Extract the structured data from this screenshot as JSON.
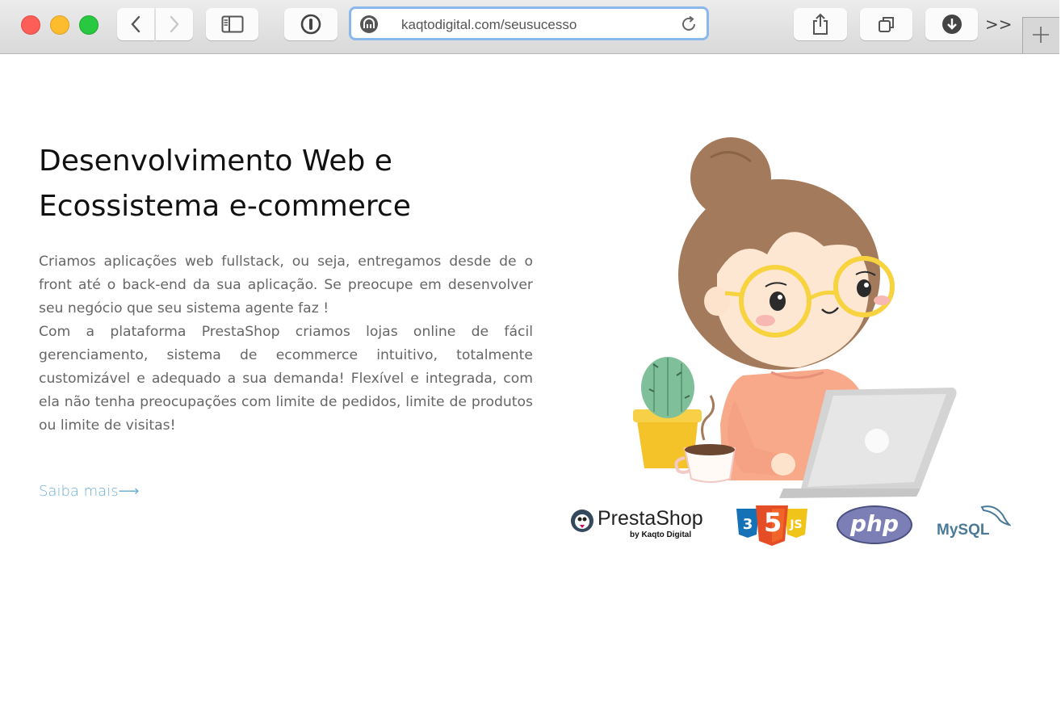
{
  "browser": {
    "url": "kaqtodigital.com/seusucesso",
    "overflow_label": ">>"
  },
  "hero": {
    "title_line1": "Desenvolvimento Web e",
    "title_line2": "Ecossistema e-commerce",
    "paragraph1": "Criamos aplicações web fullstack, ou seja, entregamos desde de o front até o back-end da sua aplicação. Se preocupe em desenvolver seu negócio que seu sistema agente faz !",
    "paragraph2": "Com a plataforma PrestaShop criamos lojas online de fácil gerenciamento, sistema de ecommerce intuitivo, totalmente customizável e adequado a sua demanda! Flexível e integrada, com ela  não tenha preocupações com limite de pedidos, limite de produtos ou limite de visitas!",
    "link_label": "Saiba mais⟶"
  },
  "logos": {
    "prestashop_name": "PrestaShop",
    "prestashop_by": "by Kaqto Digital",
    "html_css_js": "5",
    "php": "php",
    "mysql": "MySQL"
  },
  "colors": {
    "link": "#6fb0d6",
    "heading": "#111111",
    "body_text": "#666666",
    "url_focus": "#8bb8ec"
  },
  "icons": [
    "close-light",
    "minimize-light",
    "zoom-light",
    "back-icon",
    "forward-icon",
    "sidebar-icon",
    "password-icon",
    "site-icon",
    "reload-icon",
    "share-icon",
    "tabs-icon",
    "download-icon",
    "new-tab-icon"
  ]
}
